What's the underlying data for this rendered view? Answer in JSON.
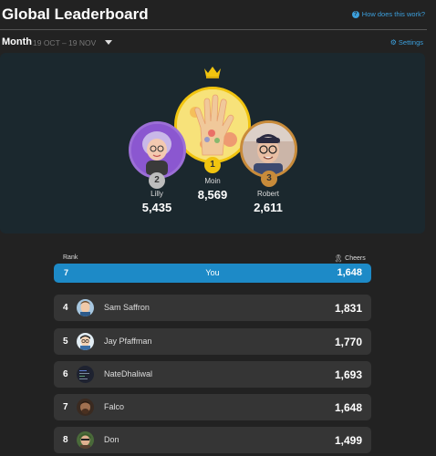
{
  "header": {
    "title": "Global Leaderboard",
    "help_link": "How does this work?"
  },
  "period": {
    "label": "Month",
    "range": "19 OCT – 19 NOV",
    "settings": "Settings"
  },
  "podium": [
    {
      "rank": "1",
      "name": "Moin",
      "score": "8,569"
    },
    {
      "rank": "2",
      "name": "Lilly",
      "score": "5,435"
    },
    {
      "rank": "3",
      "name": "Robert",
      "score": "2,611"
    }
  ],
  "columns": {
    "rank": "Rank",
    "cheers": "Cheers"
  },
  "you_row": {
    "rank": "7",
    "name": "You",
    "cheers": "1,648"
  },
  "rows": [
    {
      "rank": "4",
      "name": "Sam Saffron",
      "cheers": "1,831"
    },
    {
      "rank": "5",
      "name": "Jay Pfaffman",
      "cheers": "1,770"
    },
    {
      "rank": "6",
      "name": "NateDhaliwal",
      "cheers": "1,693"
    },
    {
      "rank": "7",
      "name": "Falco",
      "cheers": "1,648"
    },
    {
      "rank": "8",
      "name": "Don",
      "cheers": "1,499"
    }
  ],
  "colors": {
    "accent": "#1d8ac7",
    "link": "#3c9fdc",
    "gold": "#f1c40f",
    "silver": "#bdbdbd",
    "bronze": "#c88b3a"
  }
}
